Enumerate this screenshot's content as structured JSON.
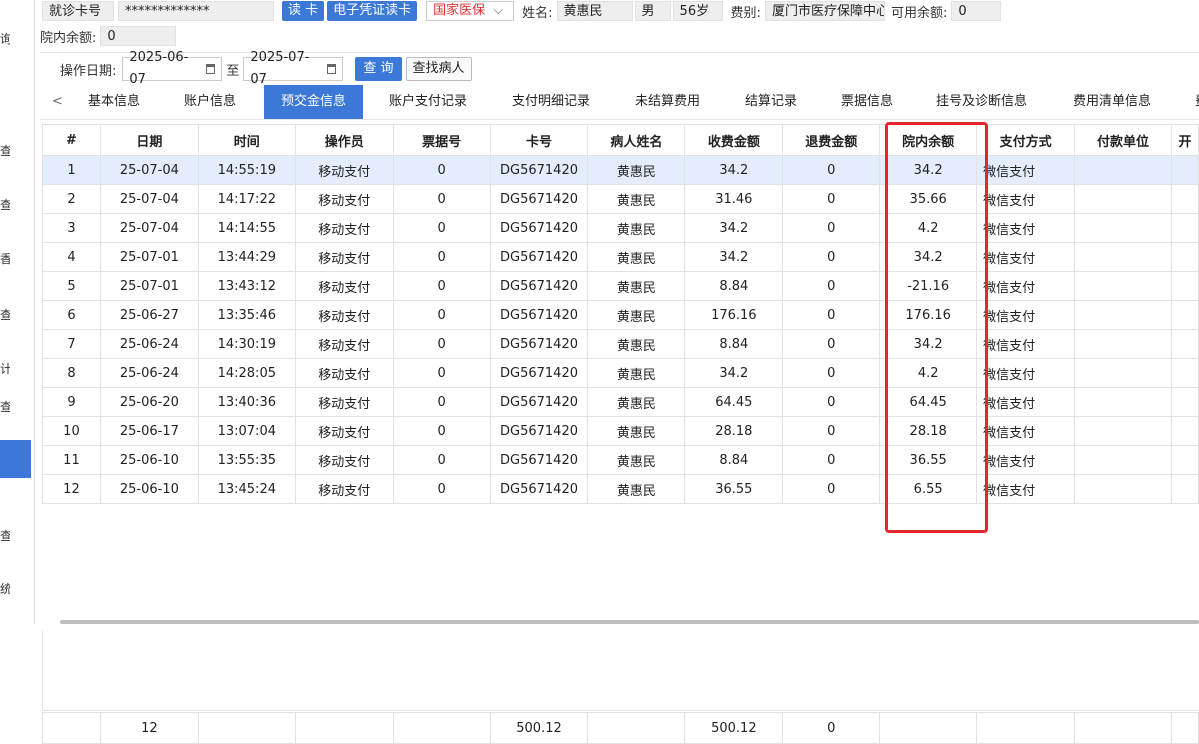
{
  "header": {
    "card_label": "就诊卡号",
    "card_value": "*************",
    "read_card_label": "读 卡",
    "e_card_label": "电子凭证读卡",
    "insurance_select": "国家医保",
    "name_label": "姓名:",
    "name_value": "黄惠民",
    "gender": "男",
    "age": "56岁",
    "fee_type_label": "费别:",
    "fee_type_value": "厦门市医疗保障中心",
    "available_balance_label": "可用余额:",
    "available_balance_value": "0",
    "hospital_balance_label": "院内余额:",
    "hospital_balance_value": "0"
  },
  "filter": {
    "op_date_label": "操作日期:",
    "date_from": "2025-06-07",
    "to_label": "至",
    "date_to": "2025-07-07",
    "query_label": "查 询",
    "find_patient_label": "查找病人"
  },
  "sidebar": {
    "glyphs": [
      "询",
      "查",
      "查",
      "香",
      "查",
      "计",
      "查",
      "查",
      "统"
    ]
  },
  "tabs": {
    "prev": "<",
    "items": [
      "基本信息",
      "账户信息",
      "预交金信息",
      "账户支付记录",
      "支付明细记录",
      "未结算费用",
      "结算记录",
      "票据信息",
      "挂号及诊断信息",
      "费用清单信息",
      "费"
    ],
    "active_index": 2
  },
  "table": {
    "columns": [
      "#",
      "日期",
      "时间",
      "操作员",
      "票据号",
      "卡号",
      "病人姓名",
      "收费金额",
      "退费金额",
      "院内余额",
      "支付方式",
      "付款单位",
      "开"
    ],
    "rows": [
      [
        "1",
        "25-07-04",
        "14:55:19",
        "移动支付",
        "0",
        "DG5671420",
        "黄惠民",
        "34.2",
        "0",
        "34.2",
        "微信支付",
        "",
        ""
      ],
      [
        "2",
        "25-07-04",
        "14:17:22",
        "移动支付",
        "0",
        "DG5671420",
        "黄惠民",
        "31.46",
        "0",
        "35.66",
        "微信支付",
        "",
        ""
      ],
      [
        "3",
        "25-07-04",
        "14:14:55",
        "移动支付",
        "0",
        "DG5671420",
        "黄惠民",
        "34.2",
        "0",
        "4.2",
        "微信支付",
        "",
        ""
      ],
      [
        "4",
        "25-07-01",
        "13:44:29",
        "移动支付",
        "0",
        "DG5671420",
        "黄惠民",
        "34.2",
        "0",
        "34.2",
        "微信支付",
        "",
        ""
      ],
      [
        "5",
        "25-07-01",
        "13:43:12",
        "移动支付",
        "0",
        "DG5671420",
        "黄惠民",
        "8.84",
        "0",
        "-21.16",
        "微信支付",
        "",
        ""
      ],
      [
        "6",
        "25-06-27",
        "13:35:46",
        "移动支付",
        "0",
        "DG5671420",
        "黄惠民",
        "176.16",
        "0",
        "176.16",
        "微信支付",
        "",
        ""
      ],
      [
        "7",
        "25-06-24",
        "14:30:19",
        "移动支付",
        "0",
        "DG5671420",
        "黄惠民",
        "8.84",
        "0",
        "34.2",
        "微信支付",
        "",
        ""
      ],
      [
        "8",
        "25-06-24",
        "14:28:05",
        "移动支付",
        "0",
        "DG5671420",
        "黄惠民",
        "34.2",
        "0",
        "4.2",
        "微信支付",
        "",
        ""
      ],
      [
        "9",
        "25-06-20",
        "13:40:36",
        "移动支付",
        "0",
        "DG5671420",
        "黄惠民",
        "64.45",
        "0",
        "64.45",
        "微信支付",
        "",
        ""
      ],
      [
        "10",
        "25-06-17",
        "13:07:04",
        "移动支付",
        "0",
        "DG5671420",
        "黄惠民",
        "28.18",
        "0",
        "28.18",
        "微信支付",
        "",
        ""
      ],
      [
        "11",
        "25-06-10",
        "13:55:35",
        "移动支付",
        "0",
        "DG5671420",
        "黄惠民",
        "8.84",
        "0",
        "36.55",
        "微信支付",
        "",
        ""
      ],
      [
        "12",
        "25-06-10",
        "13:45:24",
        "移动支付",
        "0",
        "DG5671420",
        "黄惠民",
        "36.55",
        "0",
        "6.55",
        "微信支付",
        "",
        ""
      ]
    ],
    "footer": [
      "",
      "12",
      "",
      "",
      "",
      "500.12",
      "",
      "500.12",
      "0",
      "",
      "",
      "",
      ""
    ],
    "selected_row_index": 0
  },
  "colors": {
    "accent": "#3b78d8",
    "highlight_border": "#e5262c",
    "selected_row": "#e4edfb",
    "insurance_text": "#e03030"
  }
}
